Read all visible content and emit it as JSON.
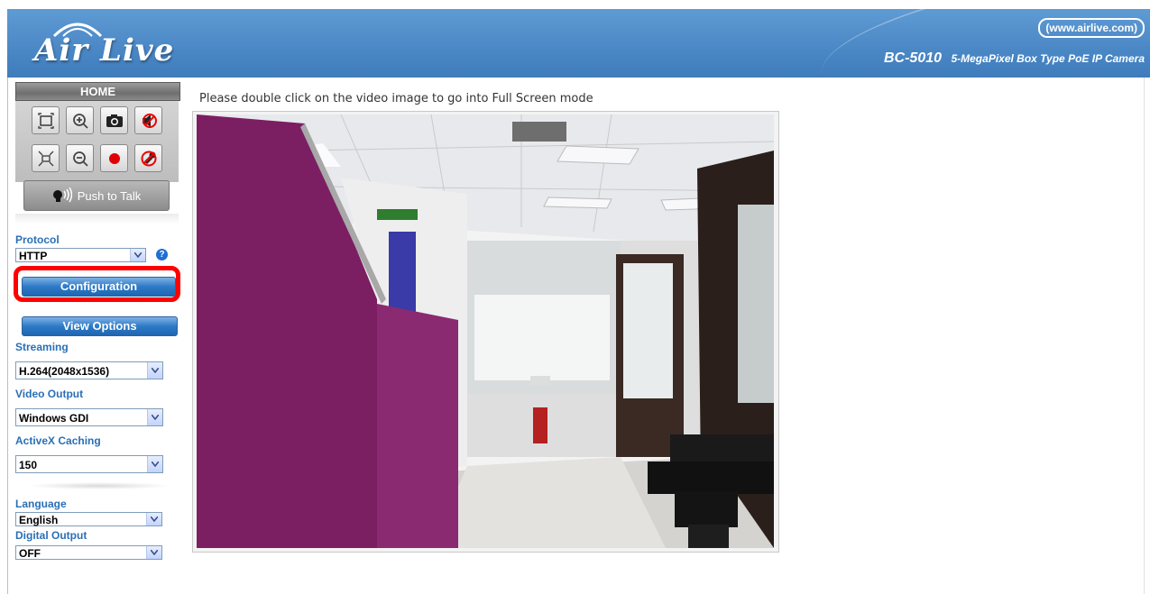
{
  "header": {
    "logo_text": "Air Live",
    "url": "(www.airlive.com)",
    "model_code": "BC-5010",
    "model_desc": "5-MegaPixel Box Type PoE IP Camera"
  },
  "sidebar": {
    "home_label": "HOME",
    "ptt_label": "Push to Talk",
    "protocol": {
      "label": "Protocol",
      "value": "HTTP",
      "help": "?"
    },
    "configuration_label": "Configuration",
    "view_options_label": "View Options",
    "streaming": {
      "label": "Streaming",
      "value": "H.264(2048x1536)"
    },
    "video_output": {
      "label": "Video Output",
      "value": "Windows GDI"
    },
    "activex_caching": {
      "label": "ActiveX Caching",
      "value": "150"
    },
    "language": {
      "label": "Language",
      "value": "English"
    },
    "digital_output": {
      "label": "Digital Output",
      "value": "OFF"
    }
  },
  "main": {
    "hint": "Please double click on the video image to go into Full Screen mode"
  },
  "colors": {
    "header_blue": "#4a87c5",
    "label_blue": "#2a6fb6",
    "highlight_red": "#ff0000"
  }
}
